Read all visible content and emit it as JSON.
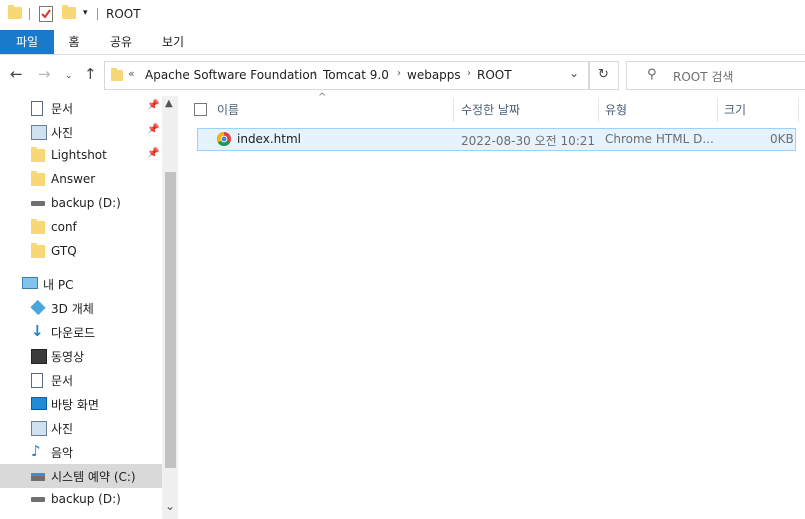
{
  "window": {
    "title": "ROOT"
  },
  "ribbon": {
    "tabs": [
      "파일",
      "홈",
      "공유",
      "보기"
    ]
  },
  "address": {
    "overflow": "«",
    "crumbs": [
      "Apache Software Foundation",
      "Tomcat 9.0",
      "webapps",
      "ROOT"
    ]
  },
  "search": {
    "placeholder": "ROOT 검색"
  },
  "sidebar": {
    "items": [
      {
        "label": "문서",
        "icon": "document-icon",
        "pinned": true
      },
      {
        "label": "사진",
        "icon": "pictures-icon",
        "pinned": true
      },
      {
        "label": "Lightshot",
        "icon": "folder-icon",
        "pinned": true
      },
      {
        "label": "Answer",
        "icon": "folder-icon",
        "pinned": false
      },
      {
        "label": "backup (D:)",
        "icon": "drive-icon",
        "pinned": false
      },
      {
        "label": "conf",
        "icon": "folder-icon",
        "pinned": false
      },
      {
        "label": "GTQ",
        "icon": "folder-icon",
        "pinned": false
      },
      {
        "label": "내 PC",
        "icon": "computer-icon",
        "pinned": false
      },
      {
        "label": "3D 개체",
        "icon": "3d-objects-icon",
        "pinned": false
      },
      {
        "label": "다운로드",
        "icon": "download-icon",
        "pinned": false
      },
      {
        "label": "동영상",
        "icon": "video-icon",
        "pinned": false
      },
      {
        "label": "문서",
        "icon": "document-icon",
        "pinned": false
      },
      {
        "label": "바탕 화면",
        "icon": "desktop-icon",
        "pinned": false
      },
      {
        "label": "사진",
        "icon": "pictures-icon",
        "pinned": false
      },
      {
        "label": "음악",
        "icon": "music-icon",
        "pinned": false
      },
      {
        "label": "시스템 예약 (C:)",
        "icon": "system-drive-icon",
        "pinned": false,
        "selected": true
      },
      {
        "label": "backup (D:)",
        "icon": "drive-icon",
        "pinned": false
      }
    ]
  },
  "columns": {
    "name": "이름",
    "modified": "수정한 날짜",
    "type": "유형",
    "size": "크기"
  },
  "files": [
    {
      "name": "index.html",
      "modified": "2022-08-30 오전 10:21",
      "type": "Chrome HTML D...",
      "size": "0KB"
    }
  ],
  "colors": {
    "accent": "#1979ca",
    "selection": "#e5f3ff",
    "folder": "#f8d775"
  }
}
